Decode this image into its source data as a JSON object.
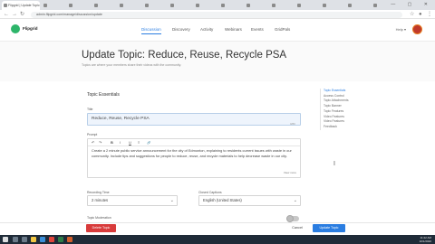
{
  "browser": {
    "tabs": [
      "Flipgrid | Update Topic",
      "",
      "",
      "",
      "",
      "",
      "",
      "",
      "",
      "",
      "",
      "",
      "",
      "",
      "",
      ""
    ],
    "url": "admin.flipgrid.com/manage/discussion/update",
    "window_controls": "— ▢ ✕"
  },
  "app": {
    "logo_text": "Flipgrid",
    "nav": [
      "Discussion",
      "Discovery",
      "Activity",
      "Webinars",
      "Events",
      "GridPals"
    ],
    "help": "Help ▾"
  },
  "page": {
    "title": "Update Topic: Reduce, Reuse, Recycle PSA",
    "subtitle": "Topics are where your members share their videos with the community."
  },
  "form": {
    "section_title": "Topic Essentials",
    "title_label": "Title",
    "title_value": "Reduce, Reuse, Recycle PSA",
    "title_counter": "0/80",
    "prompt_label": "Prompt",
    "toolbar": [
      "↶",
      "↷",
      "B",
      "I",
      "U",
      "≡",
      "🔗"
    ],
    "prompt_text": "Create a 2 minute public service announcement for the city of Edmonton, explaining to residents current issues with waste in our community. Include tips and suggestions for people to reduce, reuse, and recycle materials to help decrease waste in our city.",
    "view_more": "View more",
    "recording_label": "Recording Time",
    "recording_value": "2 minutes",
    "caption_label": "Closed Captions",
    "caption_value": "English (United States)",
    "toggle_label": "Topic Moderation"
  },
  "sidenav": [
    "Topic Essentials",
    "Access Control",
    "Topic Attachments",
    "Topic Banner",
    "Topic Features",
    "Video Features",
    "Video Features",
    "Feedback"
  ],
  "actions": {
    "delete": "Delete Topic",
    "cancel": "Cancel",
    "update": "Update Topic"
  },
  "taskbar": {
    "time": "11:22 AM",
    "date": "10/1/2020"
  },
  "colors": {
    "accent": "#2a7de1",
    "danger": "#d83b3b",
    "brand": "#2db56a"
  }
}
